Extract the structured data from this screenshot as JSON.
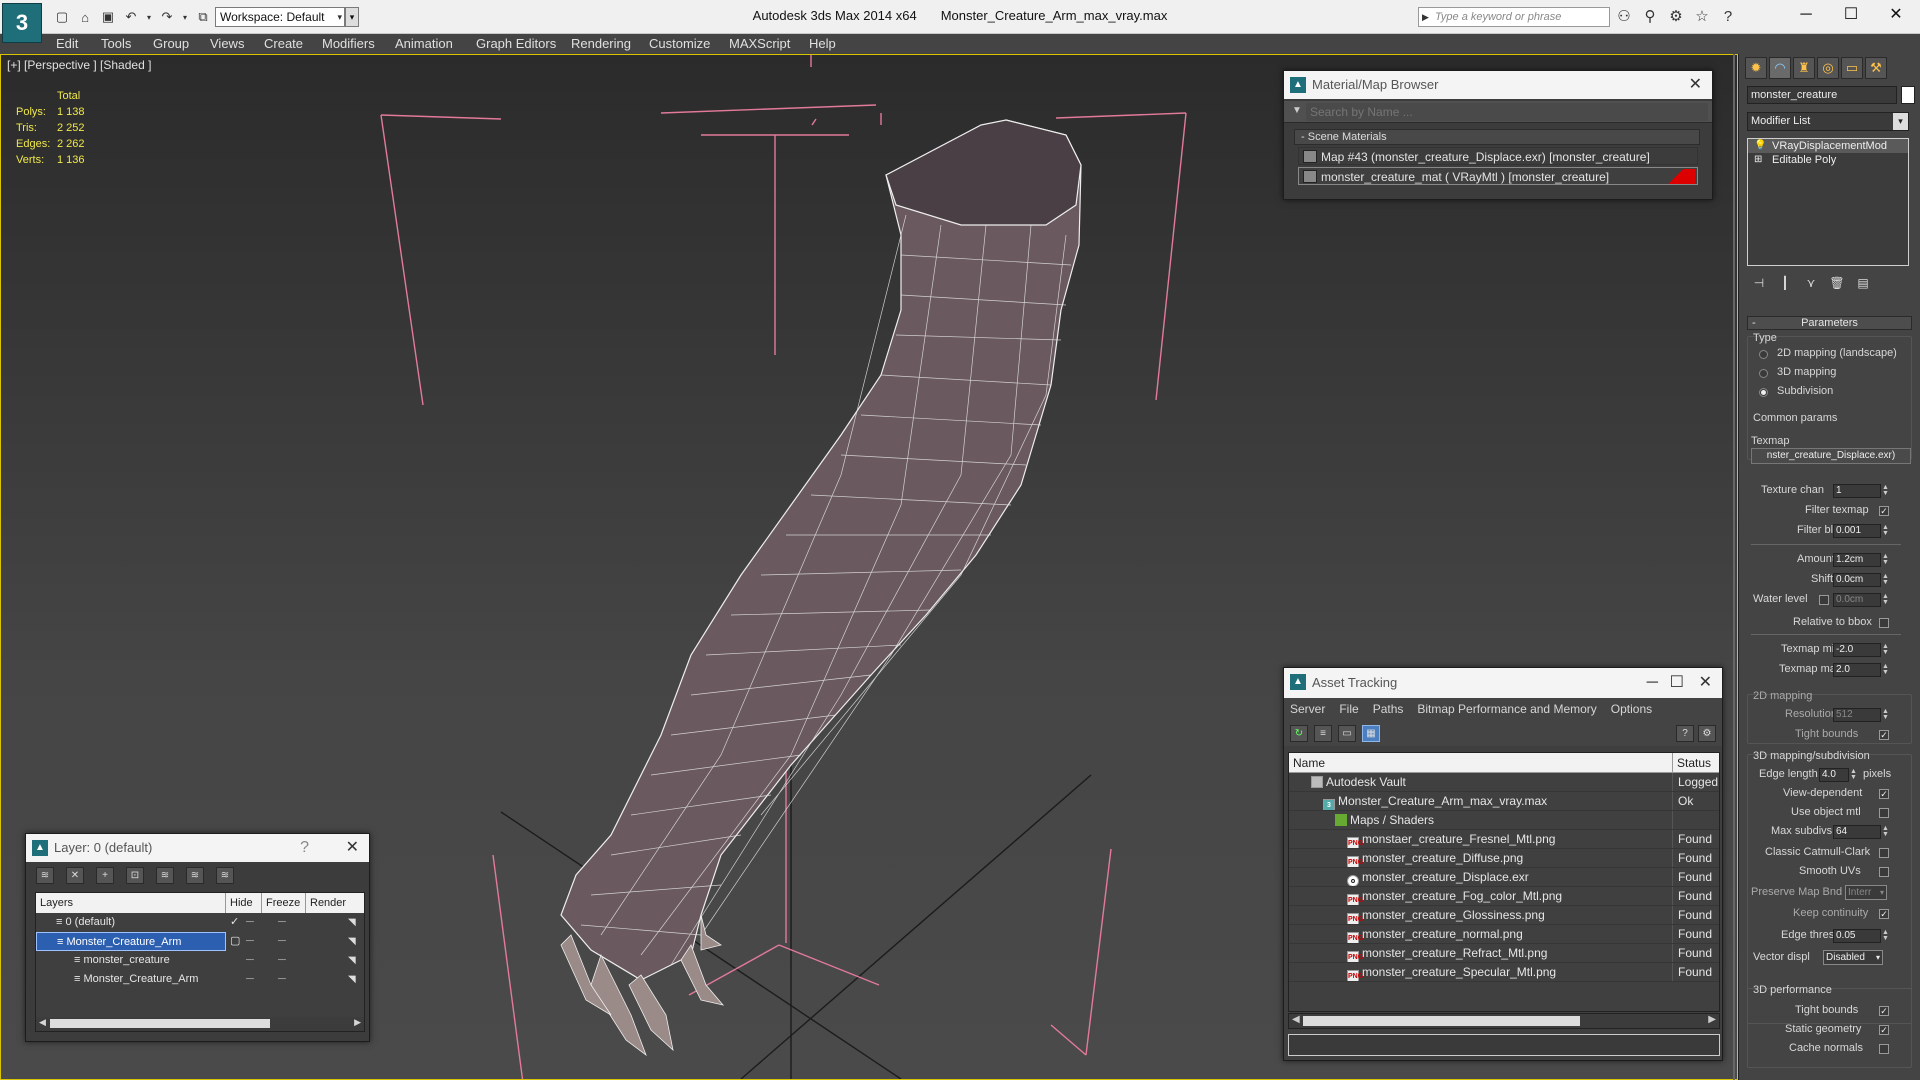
{
  "titlebar": {
    "app_name": "Autodesk 3ds Max  2014 x64",
    "file_name": "Monster_Creature_Arm_max_vray.max",
    "workspace": "Workspace: Default",
    "search_placeholder": "Type a keyword or phrase",
    "minimize": "─",
    "maximize": "☐",
    "close": "✕"
  },
  "menu": [
    "Edit",
    "Tools",
    "Group",
    "Views",
    "Create",
    "Modifiers",
    "Animation",
    "Graph Editors",
    "Rendering",
    "Customize",
    "MAXScript",
    "Help"
  ],
  "viewport": {
    "label": "[+] [Perspective ] [Shaded ]",
    "stats_header": "Total",
    "stats": [
      {
        "k": "Polys:",
        "v": "1 138"
      },
      {
        "k": "Tris:",
        "v": "2 252"
      },
      {
        "k": "Edges:",
        "v": "2 262"
      },
      {
        "k": "Verts:",
        "v": "1 136"
      }
    ]
  },
  "material_browser": {
    "title": "Material/Map Browser",
    "search_placeholder": "Search by Name ...",
    "group": "Scene Materials",
    "group_prefix": "-",
    "items": [
      "Map #43 (monster_creature_Displace.exr)  [monster_creature]",
      "monster_creature_mat  ( VRayMtl )  [monster_creature]"
    ]
  },
  "asset_tracking": {
    "title": "Asset Tracking",
    "menu": [
      "Server",
      "File",
      "Paths",
      "Bitmap Performance and Memory",
      "Options"
    ],
    "col_name": "Name",
    "col_status": "Status",
    "rows": [
      {
        "name": "Autodesk Vault",
        "status": "Logged",
        "indent": 22,
        "icon": "vault"
      },
      {
        "name": "Monster_Creature_Arm_max_vray.max",
        "status": "Ok",
        "indent": 34,
        "icon": "max"
      },
      {
        "name": "Maps / Shaders",
        "status": "",
        "indent": 46,
        "icon": "folder"
      },
      {
        "name": "monstaer_creature_Fresnel_Mtl.png",
        "status": "Found",
        "indent": 58,
        "icon": "png"
      },
      {
        "name": "monster_creature_Diffuse.png",
        "status": "Found",
        "indent": 58,
        "icon": "png"
      },
      {
        "name": "monster_creature_Displace.exr",
        "status": "Found",
        "indent": 58,
        "icon": "exr"
      },
      {
        "name": "monster_creature_Fog_color_Mtl.png",
        "status": "Found",
        "indent": 58,
        "icon": "png"
      },
      {
        "name": "monster_creature_Glossiness.png",
        "status": "Found",
        "indent": 58,
        "icon": "png"
      },
      {
        "name": "monster_creature_normal.png",
        "status": "Found",
        "indent": 58,
        "icon": "png"
      },
      {
        "name": "monster_creature_Refract_Mtl.png",
        "status": "Found",
        "indent": 58,
        "icon": "png"
      },
      {
        "name": "monster_creature_Specular_Mtl.png",
        "status": "Found",
        "indent": 58,
        "icon": "png"
      }
    ]
  },
  "layers": {
    "title": "Layer: 0 (default)",
    "help": "?",
    "cols": [
      "Layers",
      "Hide",
      "Freeze",
      "Render"
    ],
    "rows": [
      {
        "name": "0 (default)",
        "sel": false,
        "indent": 20
      },
      {
        "name": "Monster_Creature_Arm",
        "sel": true,
        "indent": 20
      },
      {
        "name": "monster_creature",
        "sel": false,
        "indent": 38
      },
      {
        "name": "Monster_Creature_Arm",
        "sel": false,
        "indent": 38
      }
    ]
  },
  "command_panel": {
    "object_name": "monster_creature",
    "modifier_list": "Modifier List",
    "stack": [
      "VRayDisplacementMod",
      "Editable Poly"
    ],
    "rollout": "Parameters",
    "type_label": "Type",
    "type_options": [
      "2D mapping (landscape)",
      "3D mapping",
      "Subdivision"
    ],
    "type_selected": "Subdivision",
    "common_label": "Common params",
    "texmap_label": "Texmap",
    "texmap_value": "nster_creature_Displace.exr)",
    "texture_chan_label": "Texture chan",
    "texture_chan": "1",
    "filter_texmap_label": "Filter texmap",
    "filter_blur_label": "Filter blur",
    "filter_blur": "0.001",
    "amount_label": "Amount",
    "amount": "1.2cm",
    "shift_label": "Shift",
    "shift": "0.0cm",
    "water_label": "Water level",
    "water": "0.0cm",
    "relative_label": "Relative to bbox",
    "texmap_min_label": "Texmap min",
    "texmap_min": "-2.0",
    "texmap_max_label": "Texmap max",
    "texmap_max": "2.0",
    "mapping2d_label": "2D mapping",
    "resolution_label": "Resolution",
    "resolution": "512",
    "tight_bounds_label": "Tight bounds",
    "sub_label": "3D mapping/subdivision",
    "edge_length_label": "Edge length",
    "edge_length": "4.0",
    "pixels_label": "pixels",
    "view_dep_label": "View-dependent",
    "use_obj_label": "Use object mtl",
    "max_subdivs_label": "Max subdivs",
    "max_subdivs": "64",
    "catmull_label": "Classic Catmull-Clark",
    "smooth_uv_label": "Smooth UVs",
    "preserve_label": "Preserve Map Bnd",
    "preserve_value": "Interr",
    "keep_cont_label": "Keep continuity",
    "edge_thresh_label": "Edge thresh",
    "edge_thresh": "0.05",
    "vector_label": "Vector displ",
    "vector_value": "Disabled",
    "perf_label": "3D performance",
    "tight_bounds2_label": "Tight bounds",
    "static_geom_label": "Static geometry",
    "cache_normals_label": "Cache normals"
  }
}
